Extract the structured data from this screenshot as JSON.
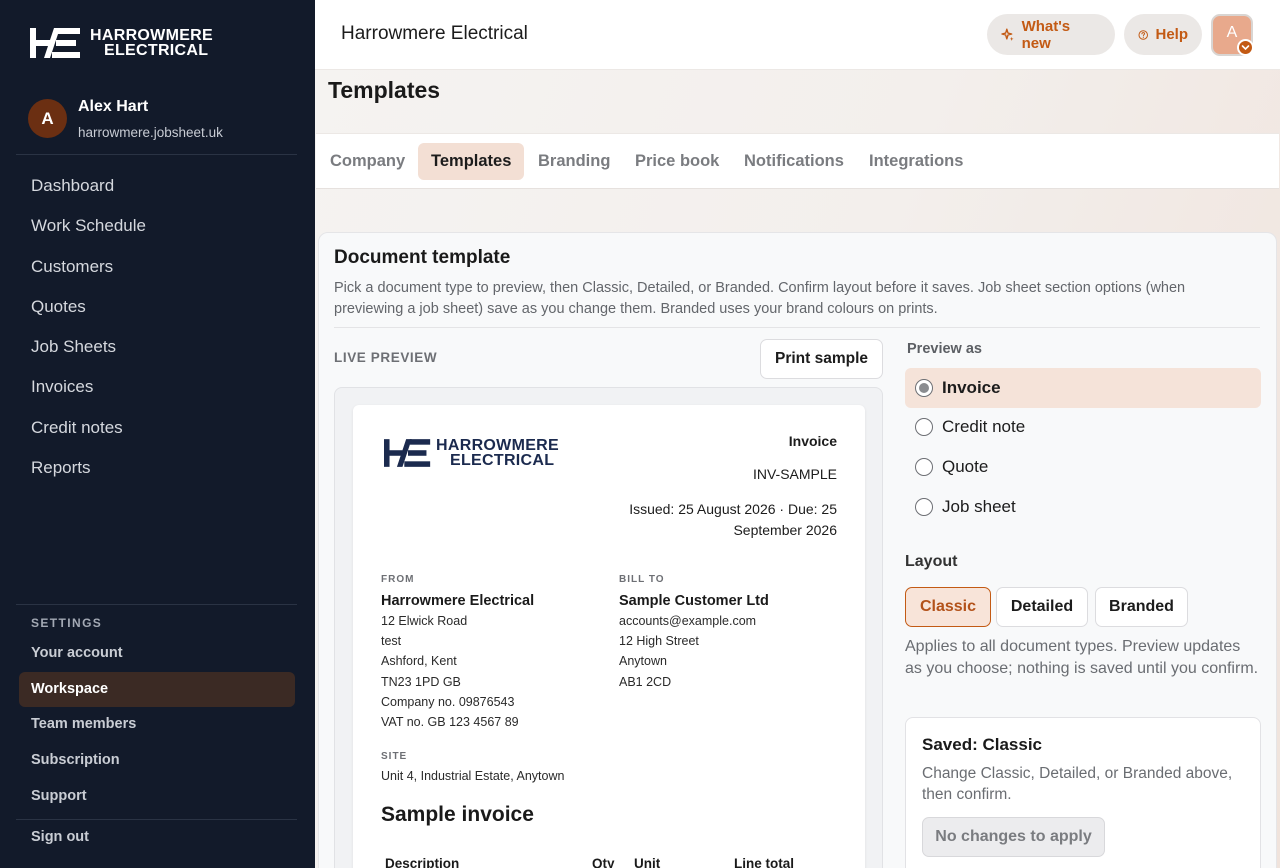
{
  "sidebar": {
    "brand_line1": "HARROWMERE",
    "brand_line2": "ELECTRICAL",
    "user": {
      "initial": "A",
      "name": "Alex Hart",
      "domain": "harrowmere.jobsheet.uk"
    },
    "nav": [
      "Dashboard",
      "Work Schedule",
      "Customers",
      "Quotes",
      "Job Sheets",
      "Invoices",
      "Credit notes",
      "Reports"
    ],
    "settings_label": "SETTINGS",
    "settings": [
      "Your account",
      "Workspace",
      "Team members",
      "Subscription",
      "Support"
    ],
    "sign_out": "Sign out"
  },
  "topbar": {
    "title": "Harrowmere Electrical",
    "whats_new": "What's new",
    "help": "Help",
    "avatar_initial": "A"
  },
  "page": {
    "title": "Templates",
    "tabs": [
      "Company",
      "Templates",
      "Branding",
      "Price book",
      "Notifications",
      "Integrations"
    ],
    "active_tab": "Templates"
  },
  "card": {
    "title": "Document template",
    "description": "Pick a document type to preview, then Classic, Detailed, or Branded. Confirm layout before it saves. Job sheet section options (when previewing a job sheet) save as you change them. Branded uses your brand colours on prints.",
    "live_preview": "LIVE PREVIEW",
    "print_sample": "Print sample"
  },
  "document": {
    "type": "Invoice",
    "number": "INV-SAMPLE",
    "dates": "Issued: 25 August 2026 · Due: 25 September 2026",
    "from_label": "FROM",
    "from": {
      "name": "Harrowmere Electrical",
      "lines": [
        "12 Elwick Road",
        "test",
        "Ashford, Kent",
        "TN23 1PD GB",
        "Company no. 09876543",
        "VAT no. GB 123 4567 89"
      ]
    },
    "bill_to_label": "BILL TO",
    "bill_to": {
      "name": "Sample Customer Ltd",
      "lines": [
        "accounts@example.com",
        "12 High Street",
        "Anytown",
        "AB1 2CD"
      ]
    },
    "site_label": "SITE",
    "site": "Unit 4, Industrial Estate, Anytown",
    "heading": "Sample invoice",
    "columns": [
      "Description",
      "Qty",
      "Unit",
      "Line total"
    ]
  },
  "panel": {
    "preview_as_label": "Preview as",
    "preview_options": [
      "Invoice",
      "Credit note",
      "Quote",
      "Job sheet"
    ],
    "selected_preview": "Invoice",
    "layout_label": "Layout",
    "layouts": [
      "Classic",
      "Detailed",
      "Branded"
    ],
    "selected_layout": "Classic",
    "layout_help": "Applies to all document types. Preview updates as you choose; nothing is saved until you confirm.",
    "saved_title": "Saved: Classic",
    "saved_desc": "Change Classic, Detailed, or Branded above, then confirm.",
    "apply_button": "No changes to apply"
  },
  "colors": {
    "sidebar_bg": "#121a2a",
    "accent": "#c35a14",
    "active_tab_bg": "#f3dfd4",
    "brand_navy": "#1b2a4e"
  },
  "icons": {
    "whats_new": "sparkle-icon",
    "help": "question-circle-icon",
    "avatar_badge": "chevron-down-icon"
  }
}
